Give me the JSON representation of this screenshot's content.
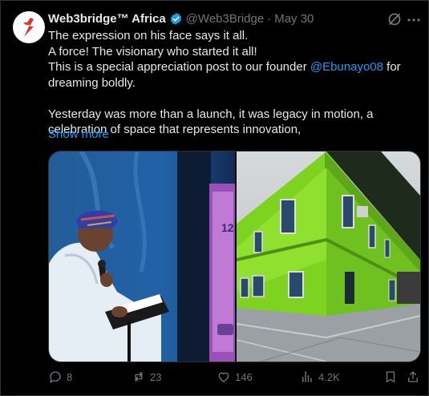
{
  "tweet": {
    "author_name": "Web3bridge™ Africa",
    "handle": "@Web3Bridge",
    "separator": "·",
    "date": "May 30",
    "lines": [
      "The expression on his face says it all.",
      "A force! The visionary who started it all!"
    ],
    "line3_pre": "This is a special appreciation post to our founder ",
    "mention": "@Ebunayo08",
    "line3_post": " for dreaming boldly.",
    "paragraph2": "Yesterday was more than a launch, it was legacy in motion, a celebration of space that represents innovation,",
    "show_more": "Show more"
  },
  "metrics": {
    "replies": "8",
    "reposts": "23",
    "likes": "146",
    "views": "4.2K"
  },
  "icons": {
    "verified": "verified-badge-icon",
    "grok": "grok-icon",
    "more": "more-icon",
    "reply": "reply-icon",
    "repost": "repost-icon",
    "like": "like-icon",
    "views": "views-icon",
    "bookmark": "bookmark-icon",
    "share": "share-icon"
  },
  "colors": {
    "background": "#000000",
    "text": "#e7e9ea",
    "muted": "#71767b",
    "accent": "#1d9bf0",
    "brand_red": "#e0312b",
    "building_green": "#7ed321"
  },
  "media_labels": {
    "photo1": "12"
  }
}
